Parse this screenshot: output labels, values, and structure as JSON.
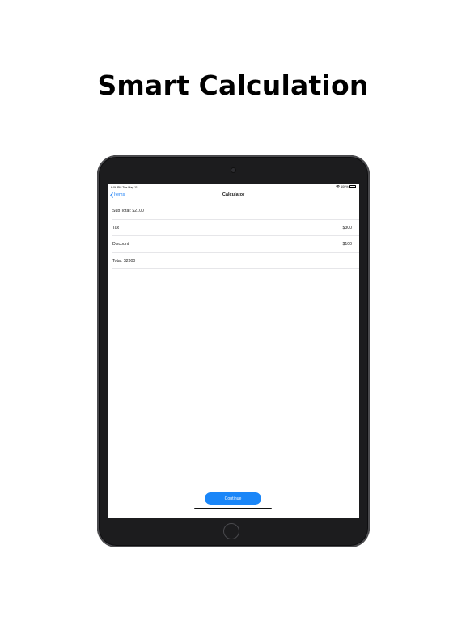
{
  "headline": "Smart Calculation",
  "status_bar": {
    "time_date": "6:06 PM   Tue May 11",
    "battery_percent": "100%"
  },
  "nav": {
    "back_label": "Items",
    "title": "Calculator"
  },
  "rows": [
    {
      "label": "Sub Total: $2100",
      "value": ""
    },
    {
      "label": "Tax",
      "value": "$300"
    },
    {
      "label": "Discount",
      "value": "$100"
    },
    {
      "label": "Total: $2300",
      "value": ""
    }
  ],
  "continue_label": "Continue",
  "colors": {
    "accent": "#1a86f8",
    "bezel": "#1c1c1e",
    "link": "#1a7ef5"
  },
  "icons": {
    "back": "chevron-left-icon",
    "wifi": "wifi-icon",
    "battery": "battery-icon"
  }
}
